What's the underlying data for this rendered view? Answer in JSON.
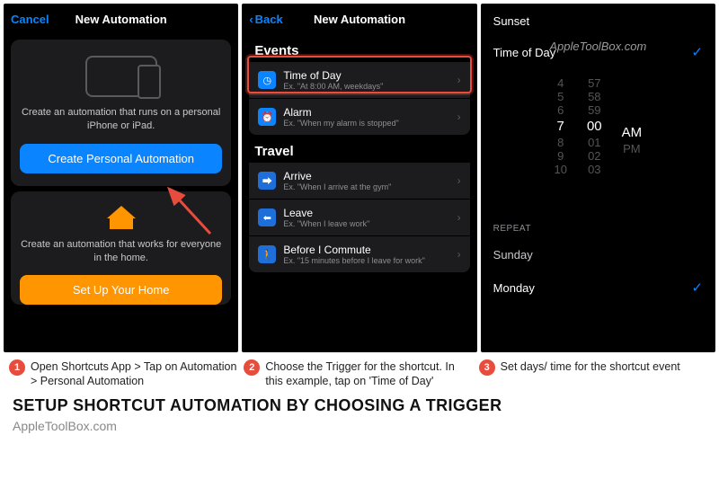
{
  "panel1": {
    "cancel": "Cancel",
    "title": "New Automation",
    "personal_desc": "Create an automation that runs on a personal iPhone or iPad.",
    "personal_btn": "Create Personal Automation",
    "home_desc": "Create an automation that works for everyone in the home.",
    "home_btn": "Set Up Your Home"
  },
  "panel2": {
    "back": "Back",
    "title": "New Automation",
    "events_hdr": "Events",
    "travel_hdr": "Travel",
    "rows": {
      "tod_label": "Time of Day",
      "tod_sub": "Ex. \"At 8:00 AM, weekdays\"",
      "alarm_label": "Alarm",
      "alarm_sub": "Ex. \"When my alarm is stopped\"",
      "arrive_label": "Arrive",
      "arrive_sub": "Ex. \"When I arrive at the gym\"",
      "leave_label": "Leave",
      "leave_sub": "Ex. \"When I leave work\"",
      "commute_label": "Before I Commute",
      "commute_sub": "Ex. \"15 minutes before I leave for work\""
    }
  },
  "panel3": {
    "sunset": "Sunset",
    "tod": "Time of Day",
    "watermark": "AppleToolBox.com",
    "wheel": {
      "h": [
        "4",
        "5",
        "6",
        "7",
        "8",
        "9",
        "10"
      ],
      "m": [
        "57",
        "58",
        "59",
        "00",
        "01",
        "02",
        "03"
      ],
      "ap": [
        "AM",
        "PM"
      ]
    },
    "repeat": "REPEAT",
    "sunday": "Sunday",
    "monday": "Monday"
  },
  "captions": {
    "c1": "Open Shortcuts App > Tap on Automation > Personal Automation",
    "c2": "Choose the Trigger for the shortcut. In this example, tap on 'Time of Day'",
    "c3": "Set days/ time for the shortcut event"
  },
  "headline": "SETUP SHORTCUT AUTOMATION BY CHOOSING A TRIGGER",
  "credit": "AppleToolBox.com"
}
